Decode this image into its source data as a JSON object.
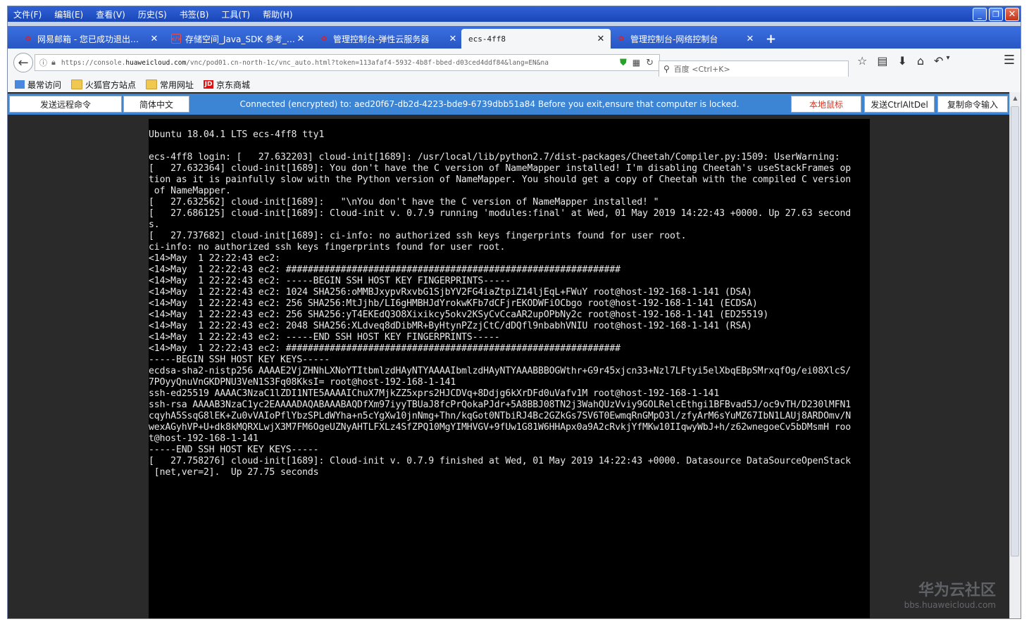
{
  "menubar": {
    "items": [
      "文件(F)",
      "编辑(E)",
      "查看(V)",
      "历史(S)",
      "书签(B)",
      "工具(T)",
      "帮助(H)"
    ],
    "window_controls": [
      "_",
      "❐",
      "✕"
    ]
  },
  "tabs": [
    {
      "label": "网易邮箱 - 您已成功退出…",
      "icon": "mail-icon",
      "active": false
    },
    {
      "label": "存储空间_Java_SDK 参考_…",
      "icon": "code-icon",
      "active": false
    },
    {
      "label": "管理控制台-弹性云服务器",
      "icon": "huawei-icon",
      "active": false
    },
    {
      "label": "ecs-4ff8",
      "icon": "none",
      "active": true
    },
    {
      "label": "管理控制台-网络控制台",
      "icon": "huawei-icon",
      "active": false
    }
  ],
  "new_tab_label": "+",
  "navbar": {
    "url_prefix": "https://console.",
    "url_domain": "huaweicloud.com",
    "url_rest": "/vnc/pod01.cn-north-1c/vnc_auto.html?token=113afaf4-5932-4b8f-bbed-d03ced4ddf84&lang=EN&na",
    "search_placeholder": "百度 <Ctrl+K>"
  },
  "bookmarks": [
    {
      "label": "最常访问",
      "icon": "most-visited-icon"
    },
    {
      "label": "火狐官方站点",
      "icon": "folder-icon"
    },
    {
      "label": "常用网址",
      "icon": "folder-icon"
    },
    {
      "label": "京东商城",
      "icon": "jd-icon",
      "icon_text": "JD"
    }
  ],
  "vnc": {
    "send_remote_cmd": "发送远程命令",
    "lang_toggle": "简体中文",
    "status": "Connected (encrypted) to: aed20f67-db2d-4223-bde9-6739dbb51a84 Before you exit,ensure that computer is locked.",
    "local_mouse": "本地鼠标",
    "send_cad": "发送CtrlAltDel",
    "copy_input": "复制命令输入"
  },
  "terminal_lines": [
    "Ubuntu 18.04.1 LTS ecs-4ff8 tty1",
    "",
    "ecs-4ff8 login: [   27.632203] cloud-init[1689]: /usr/local/lib/python2.7/dist-packages/Cheetah/Compiler.py:1509: UserWarning:",
    "[   27.632364] cloud-init[1689]: You don't have the C version of NameMapper installed! I'm disabling Cheetah's useStackFrames op",
    "tion as it is painfully slow with the Python version of NameMapper. You should get a copy of Cheetah with the compiled C version",
    " of NameMapper.",
    "[   27.632562] cloud-init[1689]:   \"\\nYou don't have the C version of NameMapper installed! \"",
    "[   27.686125] cloud-init[1689]: Cloud-init v. 0.7.9 running 'modules:final' at Wed, 01 May 2019 14:22:43 +0000. Up 27.63 second",
    "s.",
    "[   27.737682] cloud-init[1689]: ci-info: no authorized ssh keys fingerprints found for user root.",
    "ci-info: no authorized ssh keys fingerprints found for user root.",
    "<14>May  1 22:22:43 ec2:",
    "<14>May  1 22:22:43 ec2: #############################################################",
    "<14>May  1 22:22:43 ec2: -----BEGIN SSH HOST KEY FINGERPRINTS-----",
    "<14>May  1 22:22:43 ec2: 1024 SHA256:oMMBJxypvRxvbG1SjbYV2FG4iaZtpiZ14ljEqL+FWuY root@host-192-168-1-141 (DSA)",
    "<14>May  1 22:22:43 ec2: 256 SHA256:MtJjhb/LI6gHMBHJdYrokwKFb7dCFjrEKODWFiOCbgo root@host-192-168-1-141 (ECDSA)",
    "<14>May  1 22:22:43 ec2: 256 SHA256:yT4EKEdQ3O8Xixikcy5okv2KSyCvCcaAR2upOPbNy2c root@host-192-168-1-141 (ED25519)",
    "<14>May  1 22:22:43 ec2: 2048 SHA256:XLdveq8dDibMR+ByHtynPZzjCtC/dDQfl9nbabhVNIU root@host-192-168-1-141 (RSA)",
    "<14>May  1 22:22:43 ec2: -----END SSH HOST KEY FINGERPRINTS-----",
    "<14>May  1 22:22:43 ec2: #############################################################",
    "-----BEGIN SSH HOST KEY KEYS-----",
    "ecdsa-sha2-nistp256 AAAAE2VjZHNhLXNoYTItbmlzdHAyNTYAAAAIbmlzdHAyNTYAAABBBOGWthr+G9r45xjcn33+Nzl7LFtyi5elXbqEBpSMrxqfOg/ei08XlcS/",
    "7POyyQnuVnGKDPNU3VeN1S3Fq08KksI= root@host-192-168-1-141",
    "ssh-ed25519 AAAAC3NzaC1lZDI1NTE5AAAAIChuX7MjkZZ5xprs2HJCDVq+8Ddjg6kXrDFd0uVafv1M root@host-192-168-1-141",
    "ssh-rsa AAAAB3NzaC1yc2EAAAADAQABAAABAQDfXm97iyyTBUaJ8fcPrQokaPJdr+5A8BBJ08TN2j3WahQUzVviy9GOLRelcEthgi1BFBvad5J/oc9vTH/D230lMFN1",
    "cqyhA5SsqG8lEK+Zu0vVAIoPflYbzSPLdWYha+n5cYgXw10jnNmg+Thn/kqGot0NTbiRJ4Bc2GZkGs7SV6T0EwmqRnGMpO3l/zfyArM6sYuMZ67IbN1LAUj8ARDOmv/N",
    "wexAGyhVP+U+dk8kMQRXLwjX3M7FM6OgeUZNyAHTLFXLz4SfZPQ10MgYIMHVGV+9fUw1G81W6HHApx0a9A2cRvkjYfMKw10IIqwyWbJ+h/z62wnegoeCv5bDMsmH roo",
    "t@host-192-168-1-141",
    "-----END SSH HOST KEY KEYS-----",
    "[   27.758276] cloud-init[1689]: Cloud-init v. 0.7.9 finished at Wed, 01 May 2019 14:22:43 +0000. Datasource DataSourceOpenStack",
    " [net,ver=2].  Up 27.75 seconds"
  ],
  "watermark": {
    "cn": "华为云社区",
    "en": "bbs.huaweicloud.com"
  }
}
